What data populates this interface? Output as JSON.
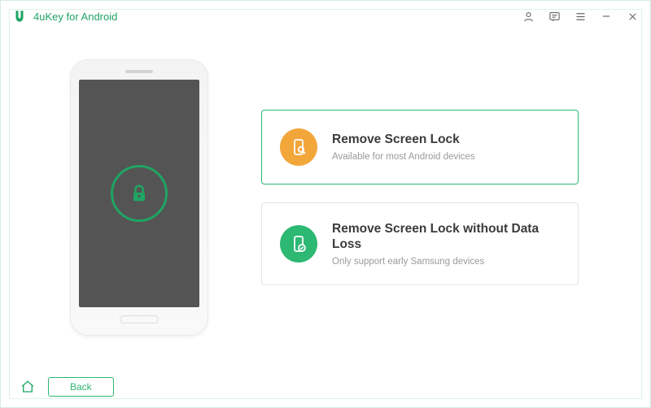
{
  "app": {
    "title": "4uKey for Android",
    "accent": "#1fa463"
  },
  "options": [
    {
      "title": "Remove Screen Lock",
      "subtitle": "Available for most Android devices",
      "icon": "phone-unlock-icon",
      "color": "orange",
      "selected": true
    },
    {
      "title": "Remove Screen Lock without Data Loss",
      "subtitle": "Only support early Samsung devices",
      "icon": "phone-check-icon",
      "color": "green",
      "selected": false
    }
  ],
  "footer": {
    "back_label": "Back"
  }
}
